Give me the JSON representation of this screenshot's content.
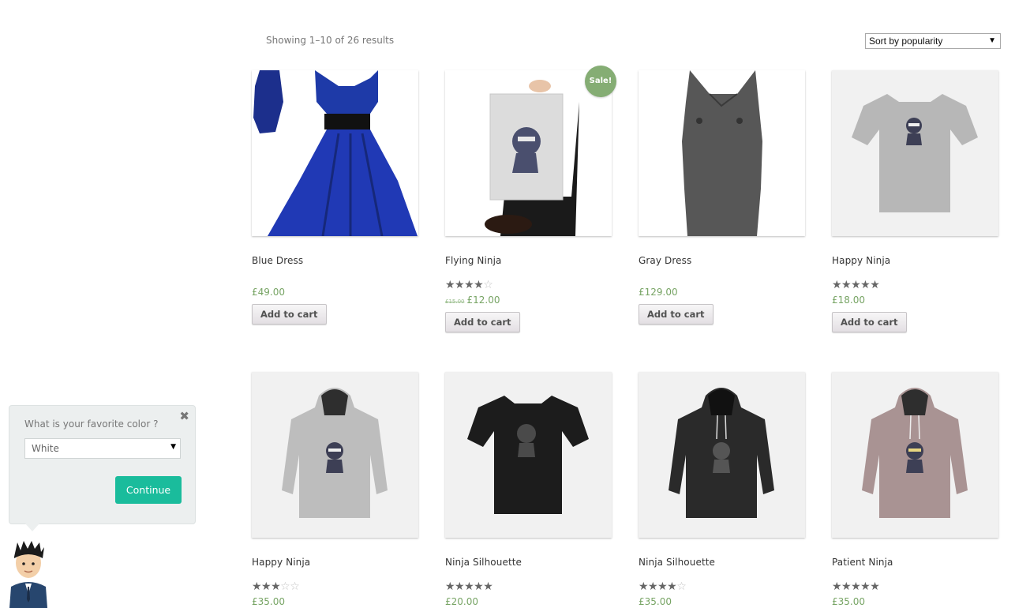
{
  "toolbar": {
    "result_count": "Showing 1–10 of 26 results",
    "orderby_selected": "Sort by popularity"
  },
  "colors": {
    "price": "#77a464",
    "sale_badge": "#85ad74",
    "continue_button": "#1abc9c"
  },
  "products": [
    {
      "title": "Blue Dress",
      "price": "£49.00",
      "button": "Add to cart"
    },
    {
      "title": "Flying Ninja",
      "rating": 4,
      "old_price": "£15.00",
      "price": "£12.00",
      "sale": "Sale!",
      "button": "Add to cart"
    },
    {
      "title": "Gray Dress",
      "price": "£129.00",
      "button": "Add to cart"
    },
    {
      "title": "Happy Ninja",
      "rating": 5,
      "price": "£18.00",
      "button": "Add to cart"
    },
    {
      "title": "Happy Ninja",
      "rating": 3,
      "price": "£35.00"
    },
    {
      "title": "Ninja Silhouette",
      "rating": 5,
      "price": "£20.00"
    },
    {
      "title": "Ninja Silhouette",
      "rating": 4,
      "price": "£35.00"
    },
    {
      "title": "Patient Ninja",
      "rating": 4.5,
      "price": "£35.00"
    }
  ],
  "chat_widget": {
    "question": "What is your favorite color ?",
    "selected_color": "White",
    "continue_label": "Continue",
    "close_icon": "close-icon"
  }
}
